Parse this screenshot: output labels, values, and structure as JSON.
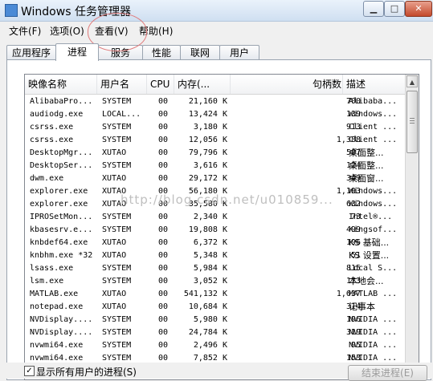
{
  "window": {
    "title": "Windows 任务管理器",
    "minimize": "▁",
    "maximize": "□",
    "close": "✕"
  },
  "menu": {
    "items": [
      {
        "label": "文件(F)"
      },
      {
        "label": "选项(O)"
      },
      {
        "label": "查看(V)"
      },
      {
        "label": "帮助(H)"
      }
    ]
  },
  "tabs": [
    {
      "label": "应用程序"
    },
    {
      "label": "进程"
    },
    {
      "label": "服务"
    },
    {
      "label": "性能"
    },
    {
      "label": "联网"
    },
    {
      "label": "用户"
    }
  ],
  "active_tab": "进程",
  "table": {
    "columns": {
      "name": "映像名称",
      "user": "用户名",
      "cpu": "CPU",
      "mem": "内存(...",
      "handles": "句柄数",
      "desc": "描述"
    },
    "rows": [
      {
        "name": "AlibabaPro...",
        "user": "SYSTEM",
        "cpu": "00",
        "mem": "21,160 K",
        "handles": "700",
        "desc": "Alibaba..."
      },
      {
        "name": "audiodg.exe",
        "user": "LOCAL...",
        "cpu": "00",
        "mem": "13,424 K",
        "handles": "139",
        "desc": "Windows..."
      },
      {
        "name": "csrss.exe",
        "user": "SYSTEM",
        "cpu": "00",
        "mem": "3,180 K",
        "handles": "913",
        "desc": "Client ..."
      },
      {
        "name": "csrss.exe",
        "user": "SYSTEM",
        "cpu": "00",
        "mem": "12,056 K",
        "handles": "1,388",
        "desc": "Client ..."
      },
      {
        "name": "DesktopMgr...",
        "user": "XUTAO",
        "cpu": "00",
        "mem": "79,796 K",
        "handles": "587",
        "desc": "桌面整..."
      },
      {
        "name": "DesktopSer...",
        "user": "SYSTEM",
        "cpu": "00",
        "mem": "3,616 K",
        "handles": "124",
        "desc": "桌面整..."
      },
      {
        "name": "dwm.exe",
        "user": "XUTAO",
        "cpu": "00",
        "mem": "29,172 K",
        "handles": "349",
        "desc": "桌面窗..."
      },
      {
        "name": "explorer.exe",
        "user": "XUTAO",
        "cpu": "00",
        "mem": "56,180 K",
        "handles": "1,193",
        "desc": "Windows..."
      },
      {
        "name": "explorer.exe",
        "user": "XUTAO",
        "cpu": "00",
        "mem": "35,580 K",
        "handles": "632",
        "desc": "Windows..."
      },
      {
        "name": "IPROSetMon...",
        "user": "SYSTEM",
        "cpu": "00",
        "mem": "2,340 K",
        "handles": "73",
        "desc": "Intel®..."
      },
      {
        "name": "kbasesrv.e...",
        "user": "SYSTEM",
        "cpu": "00",
        "mem": "19,808 K",
        "handles": "499",
        "desc": "Kingsof..."
      },
      {
        "name": "knbdef64.exe",
        "user": "XUTAO",
        "cpu": "00",
        "mem": "6,372 K",
        "handles": "196",
        "desc": "KS 基础..."
      },
      {
        "name": "knbhm.exe *32",
        "user": "XUTAO",
        "cpu": "00",
        "mem": "5,348 K",
        "handles": "51",
        "desc": "KS 设置..."
      },
      {
        "name": "lsass.exe",
        "user": "SYSTEM",
        "cpu": "00",
        "mem": "5,984 K",
        "handles": "815",
        "desc": "Local S..."
      },
      {
        "name": "lsm.exe",
        "user": "SYSTEM",
        "cpu": "00",
        "mem": "3,052 K",
        "handles": "173",
        "desc": "本地会..."
      },
      {
        "name": "MATLAB.exe",
        "user": "XUTAO",
        "cpu": "00",
        "mem": "541,132 K",
        "handles": "1,637",
        "desc": "MATLAB ..."
      },
      {
        "name": "notepad.exe",
        "user": "XUTAO",
        "cpu": "00",
        "mem": "10,684 K",
        "handles": "314",
        "desc": "记事本"
      },
      {
        "name": "NVDisplay....",
        "user": "SYSTEM",
        "cpu": "00",
        "mem": "5,980 K",
        "handles": "196",
        "desc": "NVIDIA ..."
      },
      {
        "name": "NVDisplay....",
        "user": "SYSTEM",
        "cpu": "00",
        "mem": "24,784 K",
        "handles": "319",
        "desc": "NVIDIA ..."
      },
      {
        "name": "nvwmi64.exe",
        "user": "SYSTEM",
        "cpu": "00",
        "mem": "2,496 K",
        "handles": "95",
        "desc": "NVIDIA ..."
      },
      {
        "name": "nvwmi64.exe",
        "user": "SYSTEM",
        "cpu": "00",
        "mem": "7,852 K",
        "handles": "153",
        "desc": "NVIDIA ..."
      }
    ]
  },
  "watermark": "http://blog.csdn.net/u010859...",
  "footer": {
    "show_all_users": "显示所有用户的进程(S)",
    "end_process": "结束进程(E)"
  }
}
